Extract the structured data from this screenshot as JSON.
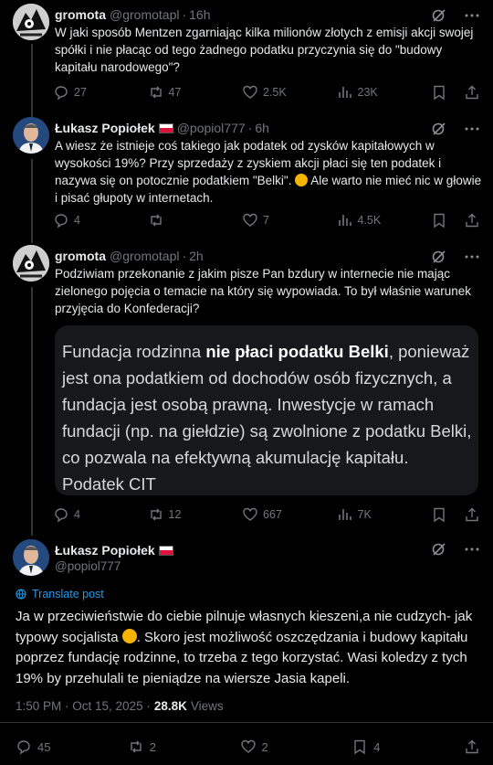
{
  "colors": {
    "background": "#000000",
    "accent": "#1d9bf0",
    "muted": "#71767b",
    "text": "#e7e9ea",
    "grok": "#e7e9ea"
  },
  "tweet1": {
    "name": "gromota",
    "handle": "@gromotapl",
    "dot": "·",
    "time": "16h",
    "text": "W jaki sposób Mentzen zgarniając kilka milionów złotych z emisji akcji swojej spółki i nie płacąc od tego żadnego podatku przyczynia się do \"budowy kapitału narodowego\"?",
    "stats": {
      "replies": "27",
      "reposts": "47",
      "likes": "2.5K",
      "views": "23K"
    }
  },
  "tweet2": {
    "name": "Łukasz Popiołek",
    "handle": "@popiol777",
    "dot": "·",
    "time": "6h",
    "text_before": "A wiesz że istnieje coś takiego jak podatek od zysków kapitałowych w wysokości 19%? Przy sprzedaży z zyskiem akcji płaci się ten podatek i nazywa się on potocznie podatkiem \"Belki\".",
    "text_after": " Ale warto nie mieć nic w głowie i pisać głupoty w internetach.",
    "stats": {
      "replies": "4",
      "reposts": "",
      "likes": "7",
      "views": "4.5K"
    }
  },
  "tweet3": {
    "name": "gromota",
    "handle": "@gromotapl",
    "dot": "·",
    "time": "2h",
    "text": "Podziwiam przekonanie z jakim pisze Pan bzdury w internecie nie mając zielonego pojęcia o temacie na który się wypowiada. To był właśnie warunek przyjęcia do Konfederacji?",
    "quote": {
      "before": "Fundacja rodzinna ",
      "bold": "nie płaci podatku Belki",
      "after": ", ponieważ jest ona podatkiem od dochodów osób fizycznych, a fundacja jest osobą prawną. Inwestycje w ramach fundacji (np. na giełdzie) są zwolnione z podatku Belki, co pozwala na efektywną akumulację kapitału. Podatek CIT"
    },
    "stats": {
      "replies": "4",
      "reposts": "12",
      "likes": "667",
      "views": "7K"
    }
  },
  "main": {
    "name": "Łukasz Popiołek",
    "handle": "@popiol777",
    "translate": "Translate post",
    "text_before": "Ja w przeciwieństwie do ciebie pilnuje własnych kieszeni,a nie cudzych- jak typowy socjalista",
    "text_after": ". Skoro jest możliwość oszczędzania i budowy kapitału poprzez fundację rodzinne, to trzeba z tego korzystać. Wasi koledzy z tych 19% by przehulali te pieniądze na wiersze Jasia kapeli.",
    "time": "1:50 PM · Oct 15, 2025 ·",
    "views_count": "28.8K",
    "views_label": "Views",
    "stats": {
      "replies": "45",
      "reposts": "2",
      "likes": "2",
      "bookmarks": "4"
    }
  }
}
